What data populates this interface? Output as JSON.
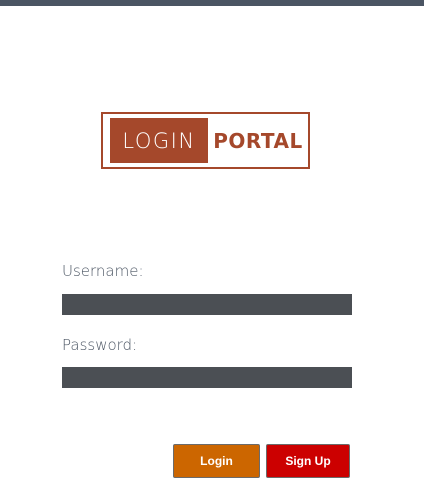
{
  "logo": {
    "left_text": "LOGIN",
    "right_text": "PORTAL"
  },
  "form": {
    "username_label": "Username:",
    "username_value": "",
    "password_label": "Password:",
    "password_value": ""
  },
  "buttons": {
    "login_label": "Login",
    "signup_label": "Sign Up"
  },
  "colors": {
    "top_bar": "#4b5563",
    "brand": "#a5482b",
    "field_background": "#4b4f54",
    "login_button": "#cc6600",
    "signup_button": "#cc0000"
  }
}
